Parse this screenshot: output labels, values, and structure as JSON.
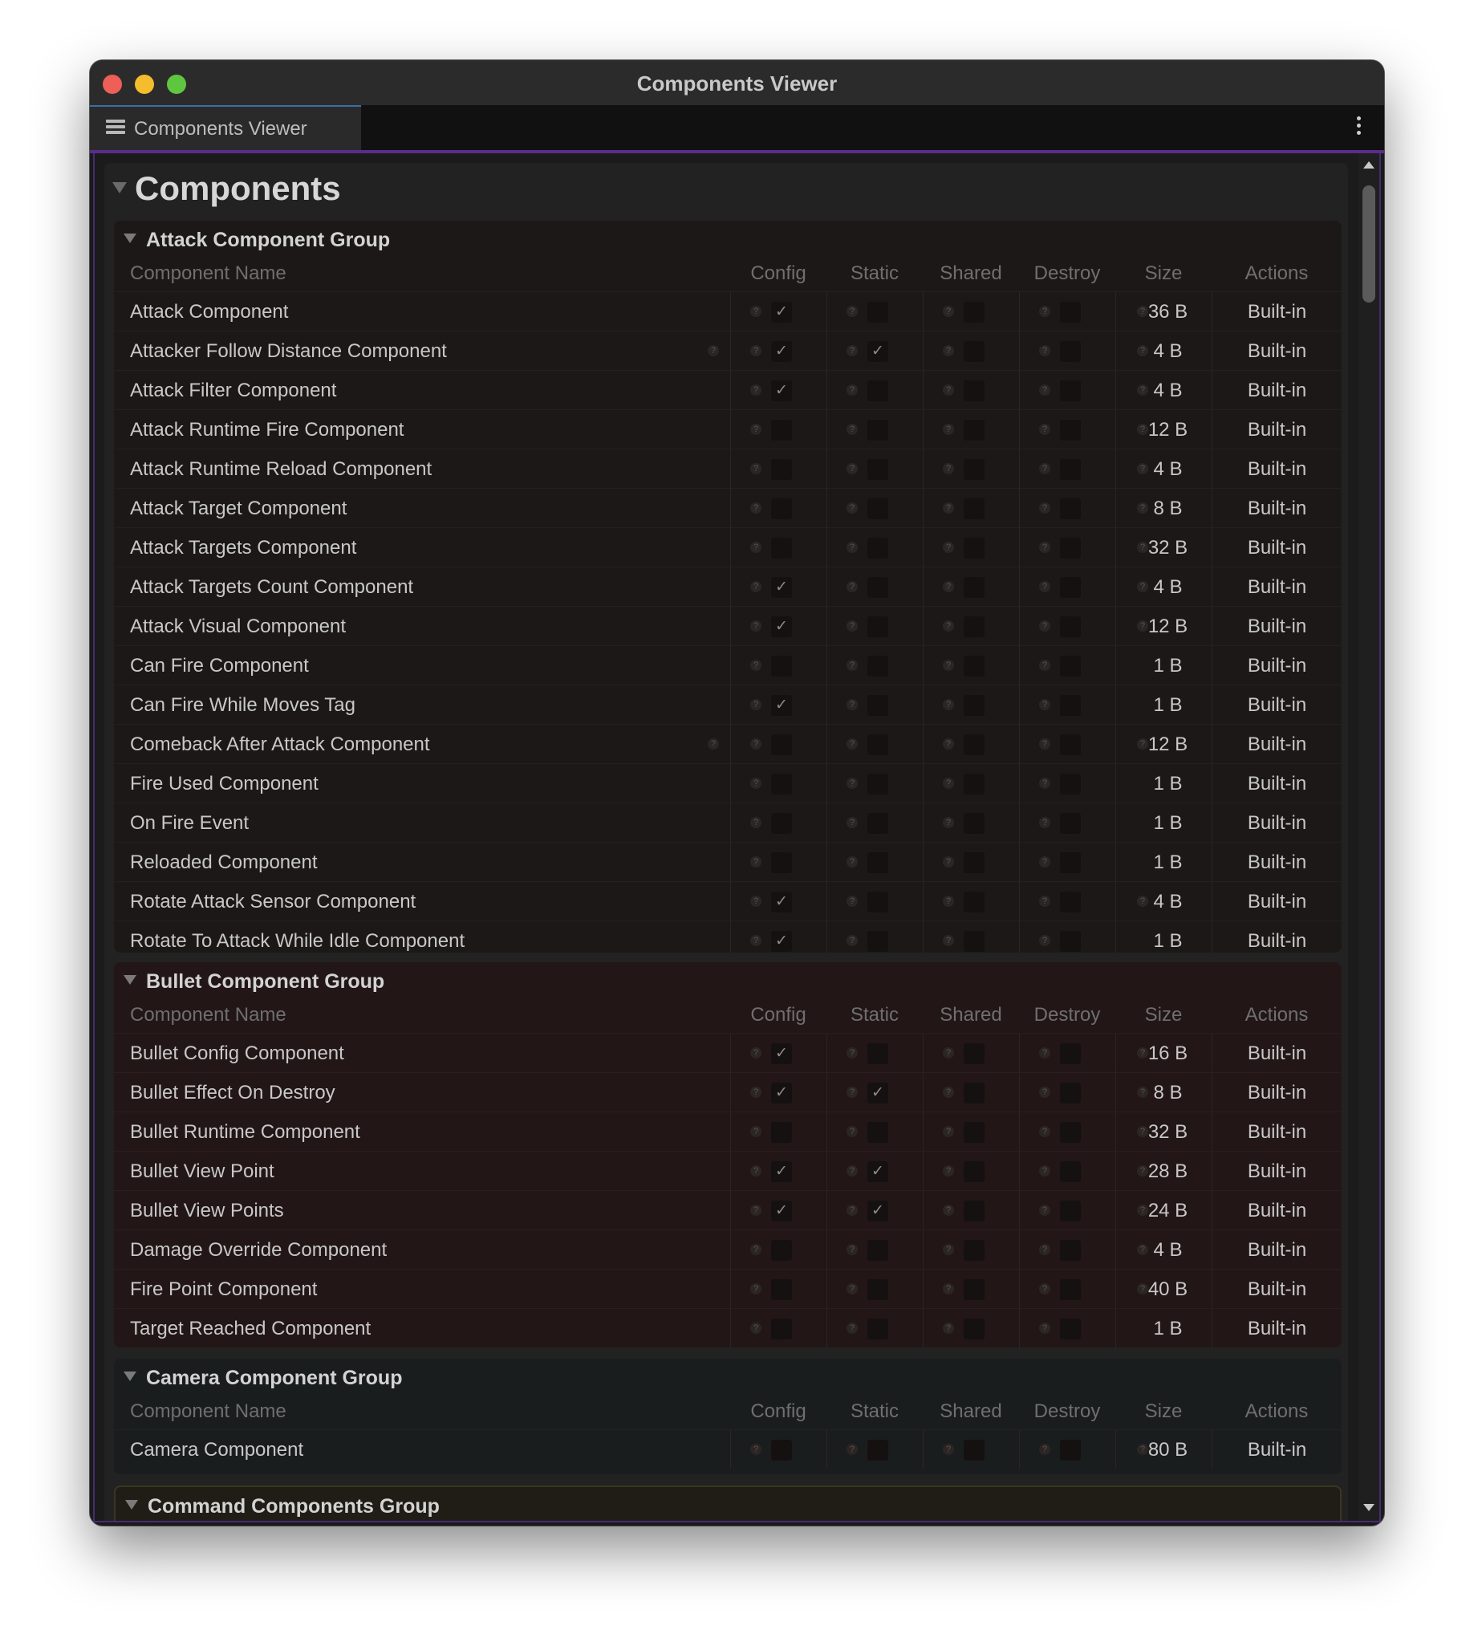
{
  "window": {
    "title": "Components Viewer"
  },
  "tab": {
    "label": "Components Viewer"
  },
  "panel": {
    "title": "Components"
  },
  "columns": {
    "name": "Component Name",
    "config": "Config",
    "static": "Static",
    "shared": "Shared",
    "destroy": "Destroy",
    "size": "Size",
    "actions": "Actions"
  },
  "groups": [
    {
      "title": "Attack Component Group",
      "rows": [
        {
          "name": "Attack Component",
          "config": true,
          "static": false,
          "size": "36 B",
          "action": "Built-in",
          "name_help": false,
          "size_help": true
        },
        {
          "name": "Attacker Follow Distance Component",
          "config": true,
          "static": true,
          "size": "4 B",
          "action": "Built-in",
          "name_help": true,
          "size_help": true
        },
        {
          "name": "Attack Filter Component",
          "config": true,
          "static": false,
          "size": "4 B",
          "action": "Built-in",
          "name_help": false,
          "size_help": true
        },
        {
          "name": "Attack Runtime Fire Component",
          "config": false,
          "static": false,
          "size": "12 B",
          "action": "Built-in",
          "name_help": false,
          "size_help": true
        },
        {
          "name": "Attack Runtime Reload Component",
          "config": false,
          "static": false,
          "size": "4 B",
          "action": "Built-in",
          "name_help": false,
          "size_help": true
        },
        {
          "name": "Attack Target Component",
          "config": false,
          "static": false,
          "size": "8 B",
          "action": "Built-in",
          "name_help": false,
          "size_help": true
        },
        {
          "name": "Attack Targets Component",
          "config": false,
          "static": false,
          "size": "32 B",
          "action": "Built-in",
          "name_help": false,
          "size_help": true
        },
        {
          "name": "Attack Targets Count Component",
          "config": true,
          "static": false,
          "size": "4 B",
          "action": "Built-in",
          "name_help": false,
          "size_help": true
        },
        {
          "name": "Attack Visual Component",
          "config": true,
          "static": false,
          "size": "12 B",
          "action": "Built-in",
          "name_help": false,
          "size_help": true
        },
        {
          "name": "Can Fire Component",
          "config": false,
          "static": false,
          "size": "1 B",
          "action": "Built-in",
          "name_help": false,
          "size_help": false
        },
        {
          "name": "Can Fire While Moves Tag",
          "config": true,
          "static": false,
          "size": "1 B",
          "action": "Built-in",
          "name_help": false,
          "size_help": false
        },
        {
          "name": "Comeback After Attack Component",
          "config": false,
          "static": false,
          "size": "12 B",
          "action": "Built-in",
          "name_help": true,
          "size_help": true
        },
        {
          "name": "Fire Used Component",
          "config": false,
          "static": false,
          "size": "1 B",
          "action": "Built-in",
          "name_help": false,
          "size_help": false
        },
        {
          "name": "On Fire Event",
          "config": false,
          "static": false,
          "size": "1 B",
          "action": "Built-in",
          "name_help": false,
          "size_help": false
        },
        {
          "name": "Reloaded Component",
          "config": false,
          "static": false,
          "size": "1 B",
          "action": "Built-in",
          "name_help": false,
          "size_help": false
        },
        {
          "name": "Rotate Attack Sensor Component",
          "config": true,
          "static": false,
          "size": "4 B",
          "action": "Built-in",
          "name_help": false,
          "size_help": true
        },
        {
          "name": "Rotate To Attack While Idle Component",
          "config": true,
          "static": false,
          "size": "1 B",
          "action": "Built-in",
          "name_help": false,
          "size_help": false
        }
      ]
    },
    {
      "title": "Bullet Component Group",
      "rows": [
        {
          "name": "Bullet Config Component",
          "config": true,
          "static": false,
          "size": "16 B",
          "action": "Built-in",
          "name_help": false,
          "size_help": true
        },
        {
          "name": "Bullet Effect On Destroy",
          "config": true,
          "static": true,
          "size": "8 B",
          "action": "Built-in",
          "name_help": false,
          "size_help": true
        },
        {
          "name": "Bullet Runtime Component",
          "config": false,
          "static": false,
          "size": "32 B",
          "action": "Built-in",
          "name_help": false,
          "size_help": true
        },
        {
          "name": "Bullet View Point",
          "config": true,
          "static": true,
          "size": "28 B",
          "action": "Built-in",
          "name_help": false,
          "size_help": true
        },
        {
          "name": "Bullet View Points",
          "config": true,
          "static": true,
          "size": "24 B",
          "action": "Built-in",
          "name_help": false,
          "size_help": true
        },
        {
          "name": "Damage Override Component",
          "config": false,
          "static": false,
          "size": "4 B",
          "action": "Built-in",
          "name_help": false,
          "size_help": true
        },
        {
          "name": "Fire Point Component",
          "config": false,
          "static": false,
          "size": "40 B",
          "action": "Built-in",
          "name_help": false,
          "size_help": true
        },
        {
          "name": "Target Reached Component",
          "config": false,
          "static": false,
          "size": "1 B",
          "action": "Built-in",
          "name_help": false,
          "size_help": false
        }
      ]
    },
    {
      "title": "Camera Component Group",
      "rows": [
        {
          "name": "Camera Component",
          "config": false,
          "static": false,
          "size": "80 B",
          "action": "Built-in",
          "name_help": false,
          "size_help": true
        }
      ]
    },
    {
      "title": "Command Components Group",
      "rows": []
    }
  ],
  "icons": {
    "tab": "list-icon",
    "menu": "kebab-menu-icon",
    "collapse": "triangle-down-icon",
    "help": "question-icon",
    "check": "checkmark-icon"
  },
  "colors": {
    "attack_group_bg": "#1d1818",
    "bullet_group_bg": "#231616",
    "camera_group_bg": "#1a1d1d",
    "command_group_bg": "#1f1d16",
    "accent_border": "#5a2d8c"
  }
}
